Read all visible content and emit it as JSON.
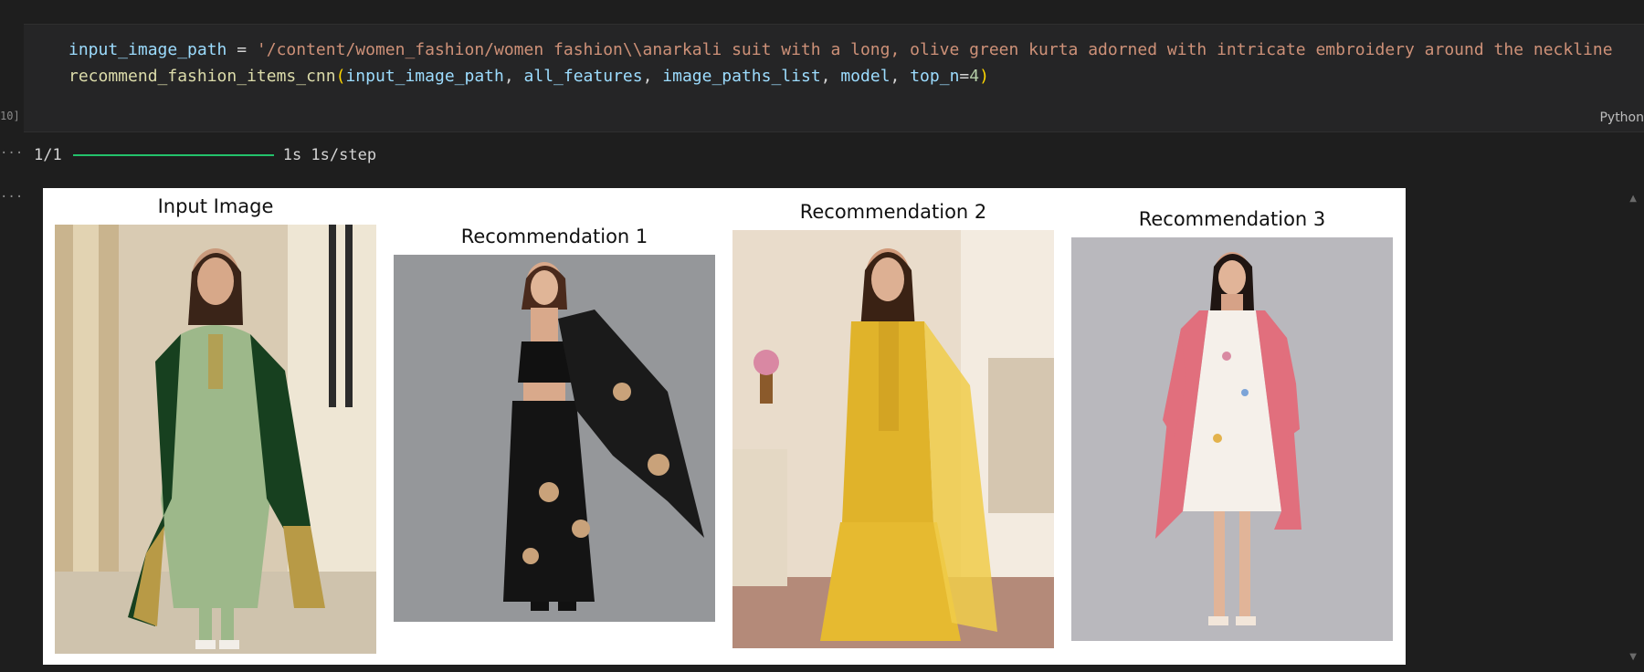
{
  "cell": {
    "execution_count": "10]",
    "language": "Python",
    "code": {
      "line1_var": "input_image_path",
      "line1_op": " = ",
      "line1_str": "'/content/women_fashion/women fashion\\\\anarkali suit with a long, olive green kurta adorned with intricate embroidery around the neckline",
      "line2_fn": "recommend_fashion_items_cnn",
      "line2_open": "(",
      "line2_arg1": "input_image_path",
      "line2_sep1": ", ",
      "line2_arg2": "all_features",
      "line2_sep2": ", ",
      "line2_arg3": "image_paths_list",
      "line2_sep3": ", ",
      "line2_arg4": "model",
      "line2_sep4": ", ",
      "line2_arg5": "top_n",
      "line2_eq": "=",
      "line2_num": "4",
      "line2_close": ")"
    }
  },
  "output": {
    "gutter_marker": "...",
    "progress": {
      "label": "1/1",
      "fraction": 1.0,
      "time": "1s 1s/step",
      "color": "#23c16b"
    },
    "figure": {
      "panels": [
        {
          "title": "Input Image"
        },
        {
          "title": "Recommendation 1"
        },
        {
          "title": "Recommendation 2"
        },
        {
          "title": "Recommendation 3"
        }
      ]
    }
  }
}
